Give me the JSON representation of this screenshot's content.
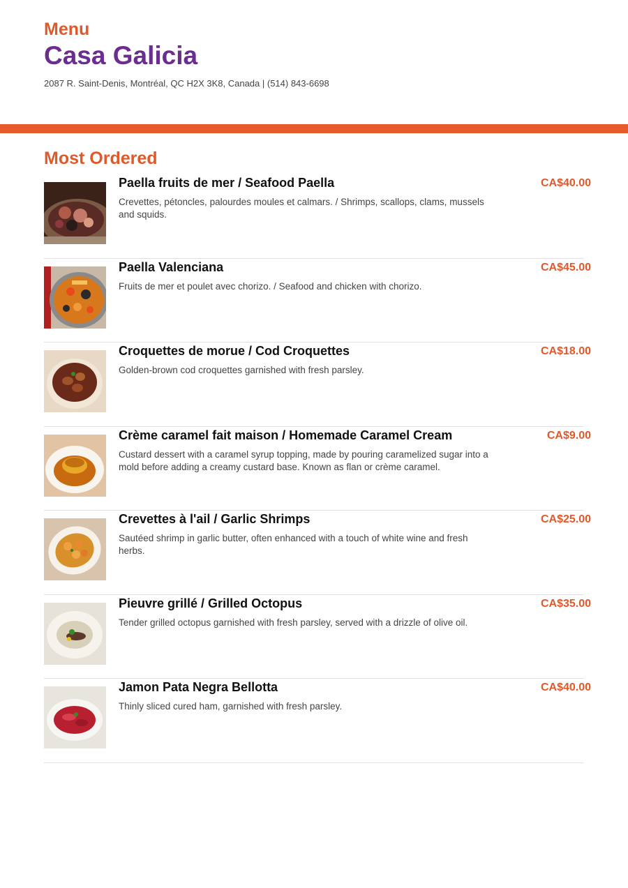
{
  "header": {
    "menu_label": "Menu",
    "restaurant_name": "Casa Galicia",
    "address": "2087 R. Saint-Denis, Montréal, QC H2X 3K8, Canada | (514) 843-6698"
  },
  "section": {
    "title": "Most Ordered"
  },
  "colors": {
    "accent": "#e0592a",
    "brand": "#6b2d8f",
    "band": "#e65a2b"
  },
  "items": [
    {
      "name": "Paella fruits de mer / Seafood Paella",
      "description": "Crevettes, pétoncles, palourdes moules et calmars. / Shrimps, scallops, clams, mussels and squids.",
      "price": "CA$40.00",
      "image": "seafood-paella-photo"
    },
    {
      "name": "Paella Valenciana",
      "description": "Fruits de mer et poulet avec chorizo. / Seafood and chicken with chorizo.",
      "price": "CA$45.00",
      "image": "paella-valenciana-photo"
    },
    {
      "name": "Croquettes de morue / Cod Croquettes",
      "description": "Golden-brown cod croquettes garnished with fresh parsley.",
      "price": "CA$18.00",
      "image": "cod-croquettes-photo"
    },
    {
      "name": "Crème caramel fait maison /  Homemade Caramel Cream",
      "description": "Custard dessert with a caramel syrup topping, made by pouring caramelized sugar into a mold before adding a creamy custard base. Known as flan or crème caramel.",
      "price": "CA$9.00",
      "image": "creme-caramel-photo"
    },
    {
      "name": "Crevettes à l'ail / Garlic Shrimps",
      "description": "Sautéed shrimp in garlic butter, often enhanced with a touch of white wine and fresh herbs.",
      "price": "CA$25.00",
      "image": "garlic-shrimps-photo"
    },
    {
      "name": "Pieuvre grillé /  Grilled Octopus",
      "description": "Tender grilled octopus garnished with fresh parsley, served with a drizzle of olive oil.",
      "price": "CA$35.00",
      "image": "grilled-octopus-photo"
    },
    {
      "name": "Jamon Pata Negra Bellotta",
      "description": "Thinly sliced cured ham, garnished with fresh parsley.",
      "price": "CA$40.00",
      "image": "jamon-photo"
    }
  ]
}
